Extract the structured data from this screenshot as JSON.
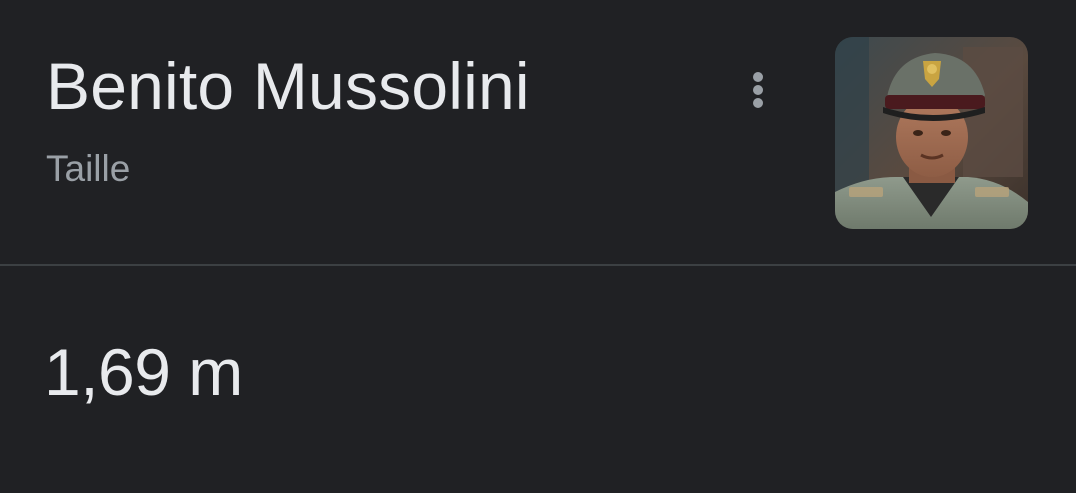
{
  "entity": {
    "name": "Benito Mussolini",
    "attribute": "Taille",
    "image_alt": "Benito Mussolini"
  },
  "answer": {
    "value": "1,69 m"
  },
  "menu": {
    "icon": "more-vert-icon"
  },
  "colors": {
    "background": "#202124",
    "primary_text": "#e8eaed",
    "secondary_text": "#9aa0a6",
    "divider": "#3c4043"
  }
}
